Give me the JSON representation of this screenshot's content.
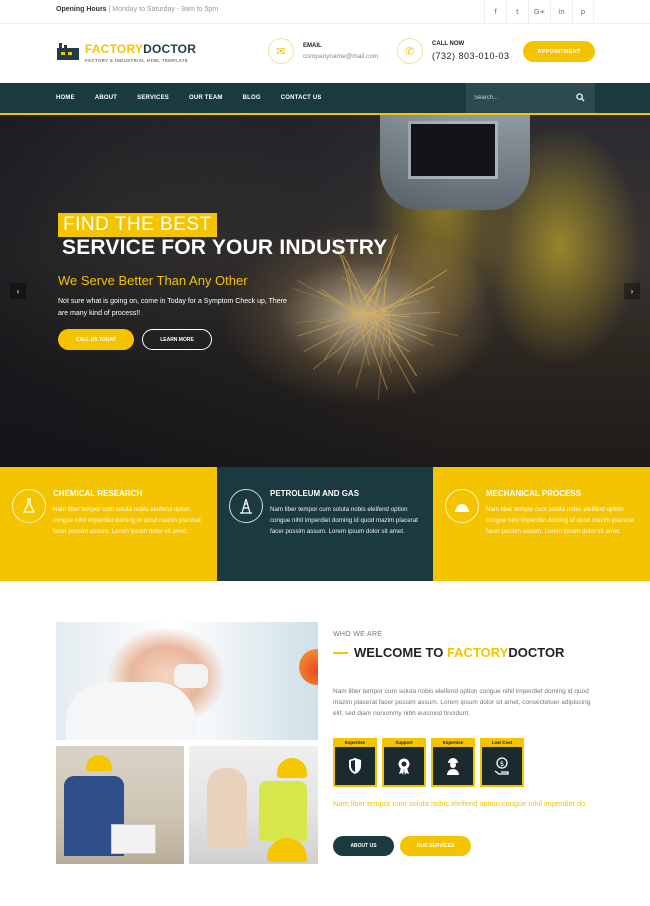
{
  "topbar": {
    "hours_label": "Opening Hours",
    "hours_days": "Monday to Saturday",
    "hours_time": "9am to 5pm",
    "social_icons": [
      "facebook-icon",
      "twitter-icon",
      "google-plus-icon",
      "linkedin-icon",
      "pinterest-icon"
    ],
    "social_glyphs": [
      "f",
      "t",
      "G+",
      "in",
      "p"
    ]
  },
  "header": {
    "logo_part1": "FACTORY",
    "logo_part2": "DOCTOR",
    "logo_sub": "FACTORY & INDUSTRIAL HTML TEMPLATE",
    "email_label": "EMAIL",
    "email_value": "companyname@mail.com",
    "call_label": "CALL NOW",
    "call_value": "(732) 803-010-03",
    "appointment_label": "APPOINTMENT"
  },
  "nav": {
    "items": [
      "HOME",
      "ABOUT",
      "SERVICES",
      "OUR TEAM",
      "BLOG",
      "CONTACT US"
    ],
    "search_placeholder": "Search..."
  },
  "hero": {
    "title1": "FIND THE BEST",
    "title2": "SERVICE FOR YOUR INDUSTRY",
    "tagline": "We Serve Better Than Any Other",
    "text": "Not sure what is going on, come in Today for a Symptom Check up, There are many kind of process!!",
    "btn_call": "CALL US TODAY",
    "btn_learn": "LEARN MORE"
  },
  "features": [
    {
      "title": "CHEMICAL RESEARCH",
      "text": "Nam liber tempor cum soluta nobis eleifend option congue nihil imperdiet doming id quod mazim placerat facer possim assum. Lorem ipsum dolor sit amet."
    },
    {
      "title": "PETROLEUM AND GAS",
      "text": "Nam liber tempor cum soluta nobis eleifend option congue nihil imperdiet doming id quod mazim placerat facer possim assum. Lorem ipsum dolor sit amet."
    },
    {
      "title": "MECHANICAL PROCESS",
      "text": "Nam liber tempor cum soluta nobis eleifend option congue nihil imperdiet doming id quod mazim placerat facer possim assum. Lorem ipsum dolor sit amet."
    }
  ],
  "about": {
    "who": "WHO WE ARE",
    "welcome_prefix": "WELCOME TO ",
    "welcome_brand1": "FACTORY",
    "welcome_brand2": "DOCTOR",
    "text": "Nam liber tempor cum soluta nobis eleifend option congue nihil imperdiet doming id quod mazim placerat facer possim assum. Lorem ipsum dolor sit amet, consectetuer adipiscing elit, sed diam nonummy nibh euismod tincidunt.",
    "skills": [
      "Expertise",
      "Support",
      "Expertise",
      "Low Cost"
    ],
    "highlight": "Nam liber tempor cum soluta nobis eleifend option congue nihil imperdiet do",
    "btn_about": "ABOUT US",
    "btn_services": "OUR SERVICES"
  },
  "colors": {
    "accent": "#f5c400",
    "dark": "#1b3a40"
  }
}
